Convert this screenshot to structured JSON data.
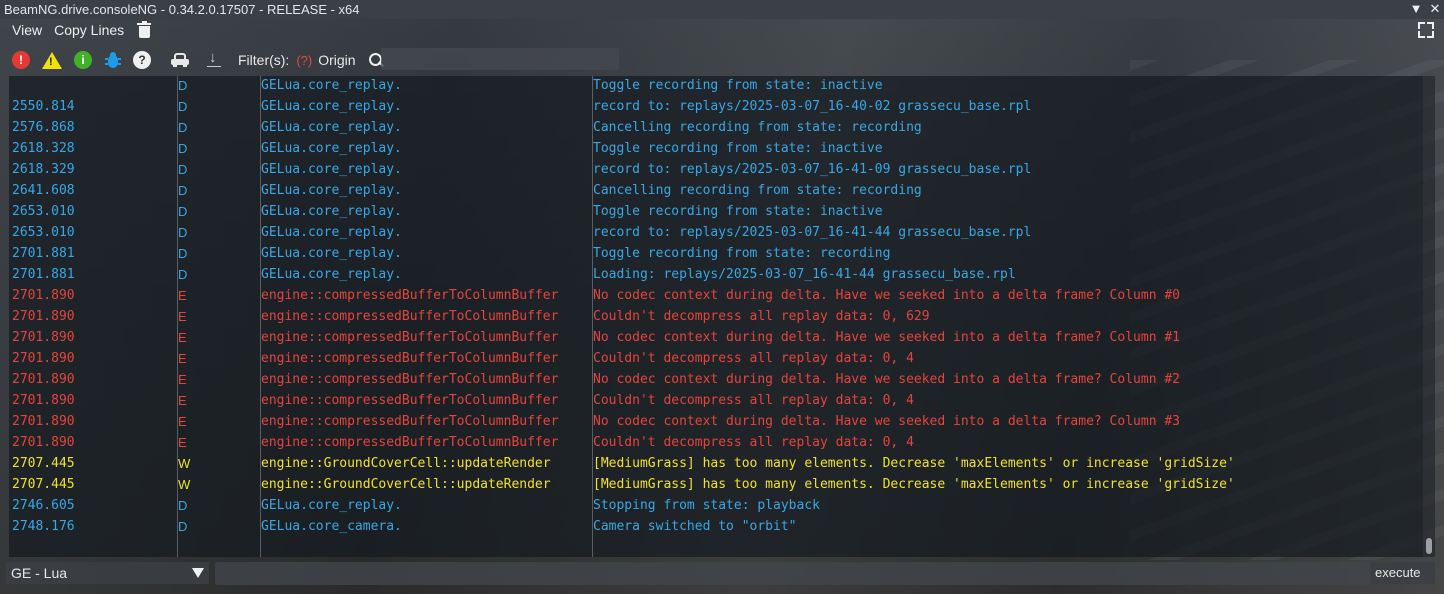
{
  "window": {
    "title": "BeamNG.drive.consoleNG - 0.34.2.0.17507 - RELEASE - x64",
    "collapse_icon": "▼",
    "close_icon": "✕"
  },
  "menu": {
    "view_label": "View",
    "copy_lines_label": "Copy Lines"
  },
  "toolbar": {
    "error_glyph": "!",
    "warning_glyph": "!",
    "info_glyph": "i",
    "help_glyph": "?",
    "download_glyph": "↓",
    "filters_label": "Filter(s):",
    "filter_help_glyph": "(?)",
    "origin_label": "Origin",
    "filter_value": ""
  },
  "colors": {
    "debug": "#3aa7e4",
    "error": "#e5443c",
    "warning": "#f0e22a"
  },
  "log_rows": [
    {
      "time": "",
      "level": "D",
      "origin": "GELua.core_replay.",
      "message": "Toggle recording from state: inactive"
    },
    {
      "time": "2550.814",
      "level": "D",
      "origin": "GELua.core_replay.",
      "message": "record to: replays/2025-03-07_16-40-02 grassecu_base.rpl"
    },
    {
      "time": "2576.868",
      "level": "D",
      "origin": "GELua.core_replay.",
      "message": "Cancelling recording from state: recording"
    },
    {
      "time": "2618.328",
      "level": "D",
      "origin": "GELua.core_replay.",
      "message": "Toggle recording from state: inactive"
    },
    {
      "time": "2618.329",
      "level": "D",
      "origin": "GELua.core_replay.",
      "message": "record to: replays/2025-03-07_16-41-09 grassecu_base.rpl"
    },
    {
      "time": "2641.608",
      "level": "D",
      "origin": "GELua.core_replay.",
      "message": "Cancelling recording from state: recording"
    },
    {
      "time": "2653.010",
      "level": "D",
      "origin": "GELua.core_replay.",
      "message": "Toggle recording from state: inactive"
    },
    {
      "time": "2653.010",
      "level": "D",
      "origin": "GELua.core_replay.",
      "message": "record to: replays/2025-03-07_16-41-44 grassecu_base.rpl"
    },
    {
      "time": "2701.881",
      "level": "D",
      "origin": "GELua.core_replay.",
      "message": "Toggle recording from state: recording"
    },
    {
      "time": "2701.881",
      "level": "D",
      "origin": "GELua.core_replay.",
      "message": "Loading: replays/2025-03-07_16-41-44 grassecu_base.rpl"
    },
    {
      "time": "2701.890",
      "level": "E",
      "origin": "engine::compressedBufferToColumnBuffer",
      "message": "No codec context during delta. Have we seeked into a delta frame? Column #0"
    },
    {
      "time": "2701.890",
      "level": "E",
      "origin": "engine::compressedBufferToColumnBuffer",
      "message": "Couldn't decompress all replay data: 0, 629"
    },
    {
      "time": "2701.890",
      "level": "E",
      "origin": "engine::compressedBufferToColumnBuffer",
      "message": "No codec context during delta. Have we seeked into a delta frame? Column #1"
    },
    {
      "time": "2701.890",
      "level": "E",
      "origin": "engine::compressedBufferToColumnBuffer",
      "message": "Couldn't decompress all replay data: 0, 4"
    },
    {
      "time": "2701.890",
      "level": "E",
      "origin": "engine::compressedBufferToColumnBuffer",
      "message": "No codec context during delta. Have we seeked into a delta frame? Column #2"
    },
    {
      "time": "2701.890",
      "level": "E",
      "origin": "engine::compressedBufferToColumnBuffer",
      "message": "Couldn't decompress all replay data: 0, 4"
    },
    {
      "time": "2701.890",
      "level": "E",
      "origin": "engine::compressedBufferToColumnBuffer",
      "message": "No codec context during delta. Have we seeked into a delta frame? Column #3"
    },
    {
      "time": "2701.890",
      "level": "E",
      "origin": "engine::compressedBufferToColumnBuffer",
      "message": "Couldn't decompress all replay data: 0, 4"
    },
    {
      "time": "2707.445",
      "level": "W",
      "origin": "engine::GroundCoverCell::updateRender",
      "message": "[MediumGrass] has too many elements. Decrease 'maxElements' or increase 'gridSize'"
    },
    {
      "time": "2707.445",
      "level": "W",
      "origin": "engine::GroundCoverCell::updateRender",
      "message": "[MediumGrass] has too many elements. Decrease 'maxElements' or increase 'gridSize'"
    },
    {
      "time": "2746.605",
      "level": "D",
      "origin": "GELua.core_replay.",
      "message": "Stopping from state: playback"
    },
    {
      "time": "2748.176",
      "level": "D",
      "origin": "GELua.core_camera.",
      "message": "Camera switched to \"orbit\""
    }
  ],
  "command_bar": {
    "context_selected": "GE - Lua",
    "command_value": "",
    "execute_label": "execute"
  }
}
